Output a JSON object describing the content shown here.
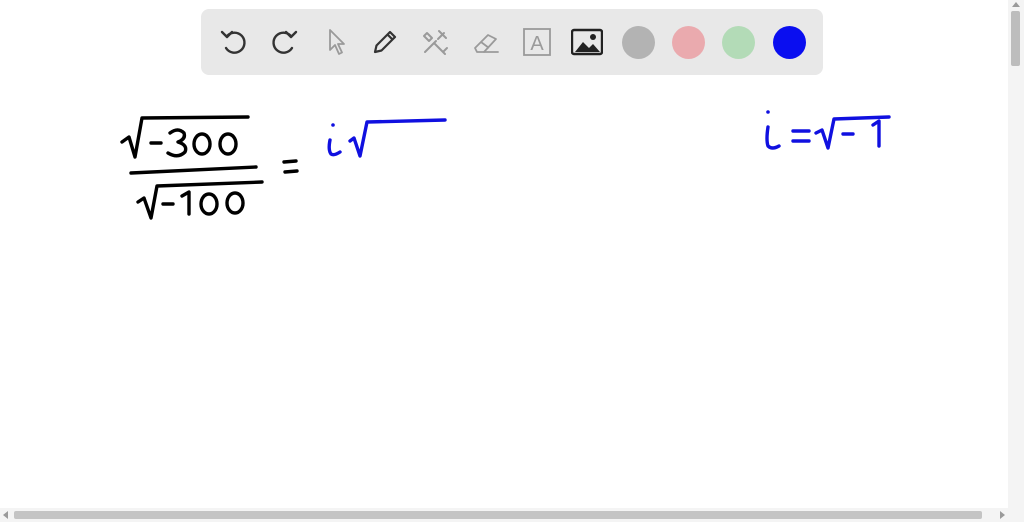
{
  "toolbar": {
    "tools": [
      {
        "name": "undo",
        "icon": "undo-icon"
      },
      {
        "name": "redo",
        "icon": "redo-icon"
      },
      {
        "name": "select",
        "icon": "cursor-arrow-icon"
      },
      {
        "name": "pen",
        "icon": "pencil-icon"
      },
      {
        "name": "tools",
        "icon": "hammer-wrench-icon"
      },
      {
        "name": "eraser",
        "icon": "eraser-icon"
      },
      {
        "name": "text",
        "icon": "text-box-icon",
        "glyph": "A"
      },
      {
        "name": "image",
        "icon": "image-icon"
      }
    ],
    "colors": [
      {
        "name": "gray",
        "hex": "#b3b3b3"
      },
      {
        "name": "pink",
        "hex": "#eaaaae"
      },
      {
        "name": "green",
        "hex": "#b3dbb7"
      },
      {
        "name": "blue",
        "hex": "#0a0ef0",
        "selected": true
      }
    ]
  },
  "canvas": {
    "handwriting": {
      "numerator": "√-300",
      "denominator": "√-100",
      "equals": "=",
      "result_partial": "i√",
      "definition": "i=√-1"
    },
    "ink_colors": {
      "black": "#000000",
      "blue": "#1010e0"
    }
  }
}
